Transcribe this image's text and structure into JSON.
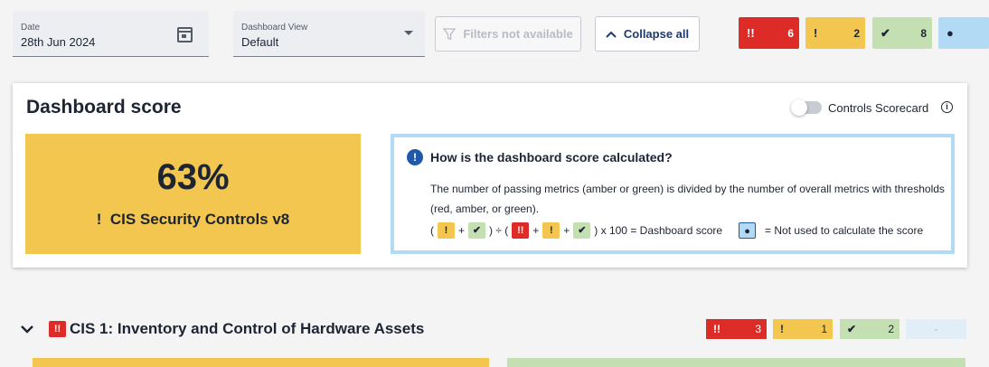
{
  "topbar": {
    "date": {
      "label": "Date",
      "value": "28th Jun 2024",
      "icon": "calendar-icon"
    },
    "view": {
      "label": "Dashboard View",
      "value": "Default",
      "icon": "dropdown-caret-icon"
    },
    "filters_label": "Filters not available",
    "collapse_label": "Collapse all",
    "summary": {
      "red": {
        "icon": "!!",
        "count": "6",
        "color": "#dd2c27"
      },
      "amber": {
        "icon": "!",
        "count": "2",
        "color": "#f2c64f"
      },
      "green": {
        "icon": "✔",
        "count": "8",
        "color": "#c4e0b2"
      },
      "blue": {
        "icon": "●",
        "count": "",
        "color": "#b3daf5"
      }
    }
  },
  "score_card": {
    "title": "Dashboard score",
    "toggle_label": "Controls Scorecard",
    "toggle_on": false,
    "score": "63%",
    "framework_icon": "!",
    "framework": "CIS Security Controls v8",
    "explain_title": "How is the dashboard score calculated?",
    "explain_body": "The number of passing metrics (amber or green) is divided by the number of overall metrics with thresholds (red, amber, or green).",
    "formula": {
      "open1": "(",
      "plus": "+",
      "divide": ") ÷ (",
      "close": ") x 100 = Dashboard score",
      "legend": "= Not used to calculate the score"
    }
  },
  "section": {
    "title": "CIS 1: Inventory and Control of Hardware Assets",
    "status_icon": "!!",
    "counts": {
      "red": "3",
      "amber": "1",
      "green": "2",
      "blue": "-"
    }
  }
}
